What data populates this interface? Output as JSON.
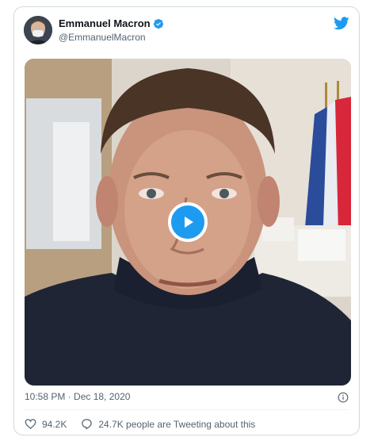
{
  "author": {
    "name": "Emmanuel Macron",
    "handle": "@EmmanuelMacron",
    "verified": true
  },
  "media": {
    "type": "video",
    "play_icon": "play-icon"
  },
  "meta": {
    "timestamp": "10:58 PM · Dec 18, 2020"
  },
  "actions": {
    "likes": "94.2K",
    "tweeting": "24.7K people are Tweeting about this"
  },
  "colors": {
    "accent": "#1d9bf0",
    "text": "#0f1419",
    "secondary": "#536471",
    "border": "#cfd9de"
  },
  "icons": {
    "brand": "twitter-bird-icon",
    "verified": "verified-badge-icon",
    "info": "info-icon",
    "like": "heart-icon",
    "reply": "speech-bubble-icon"
  }
}
